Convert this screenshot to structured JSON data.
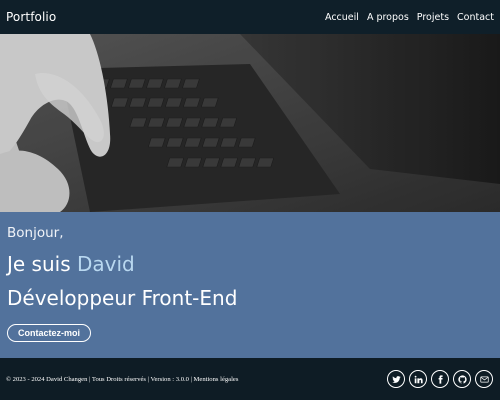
{
  "navbar": {
    "brand": "Portfolio",
    "links": [
      "Accueil",
      "A propos",
      "Projets",
      "Contact"
    ]
  },
  "hero": {
    "image": "laptop-keyboard-typing-photo"
  },
  "intro": {
    "greeting": "Bonjour,",
    "prefix": "Je suis ",
    "name": "David",
    "role": "Développeur Front-End",
    "button": "Contactez-moi"
  },
  "footer": {
    "text": "© 2023 - 2024 David Changen | Tous Droits réservés | Version : 3.0.0 | Mentions légales",
    "socials": [
      "twitter-icon",
      "linkedin-icon",
      "facebook-icon",
      "github-icon",
      "mail-icon"
    ]
  },
  "colors": {
    "navbar_bg": "#0f1f29",
    "intro_bg": "#52729c",
    "name_accent": "#b9d8f0",
    "footer_bg": "#0e1c25"
  }
}
